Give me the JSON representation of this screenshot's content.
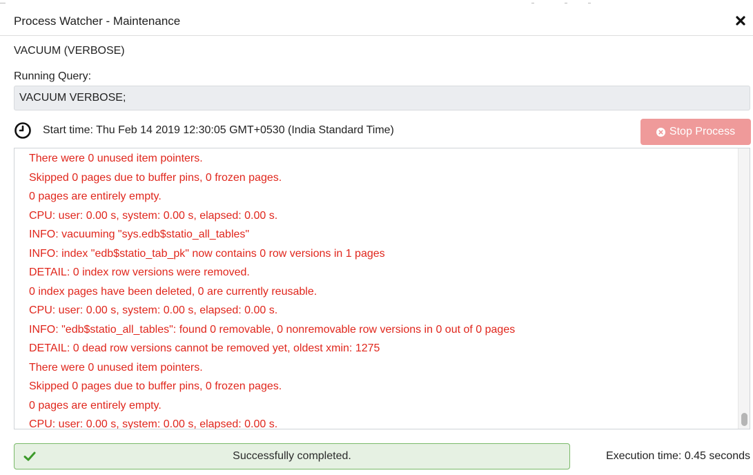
{
  "dialog": {
    "title": "Process Watcher - Maintenance",
    "operation": "VACUUM (VERBOSE)",
    "running_query_label": "Running Query:",
    "query": "VACUUM VERBOSE;",
    "start_time": "Start time: Thu Feb 14 2019 12:30:05 GMT+0530 (India Standard Time)",
    "stop_button_label": "Stop Process"
  },
  "log": {
    "lines": [
      "There were 0 unused item pointers.",
      "Skipped 0 pages due to buffer pins, 0 frozen pages.",
      "0 pages are entirely empty.",
      "CPU: user: 0.00 s, system: 0.00 s, elapsed: 0.00 s.",
      "INFO:  vacuuming \"sys.edb$statio_all_tables\"",
      "INFO:  index \"edb$statio_tab_pk\" now contains 0 row versions in 1 pages",
      "DETAIL:  0 index row versions were removed.",
      "0 index pages have been deleted, 0 are currently reusable.",
      "CPU: user: 0.00 s, system: 0.00 s, elapsed: 0.00 s.",
      "INFO:  \"edb$statio_all_tables\": found 0 removable, 0 nonremovable row versions in 0 out of 0 pages",
      "DETAIL:  0 dead row versions cannot be removed yet, oldest xmin: 1275",
      "There were 0 unused item pointers.",
      "Skipped 0 pages due to buffer pins, 0 frozen pages.",
      "0 pages are entirely empty.",
      "CPU: user: 0.00 s, system: 0.00 s, elapsed: 0.00 s."
    ]
  },
  "status": {
    "message": "Successfully completed.",
    "execution_time": "Execution time: 0.45 seconds"
  },
  "colors": {
    "log_text": "#e0261c",
    "stop_button": "#ef9a9a",
    "success_bg": "#e6f1e3",
    "success_border": "#79b968",
    "success_icon": "#3c9a2a"
  },
  "icons": {
    "close": "close-icon",
    "clock": "clock-icon",
    "stop": "times-circle-icon",
    "check": "check-icon"
  }
}
